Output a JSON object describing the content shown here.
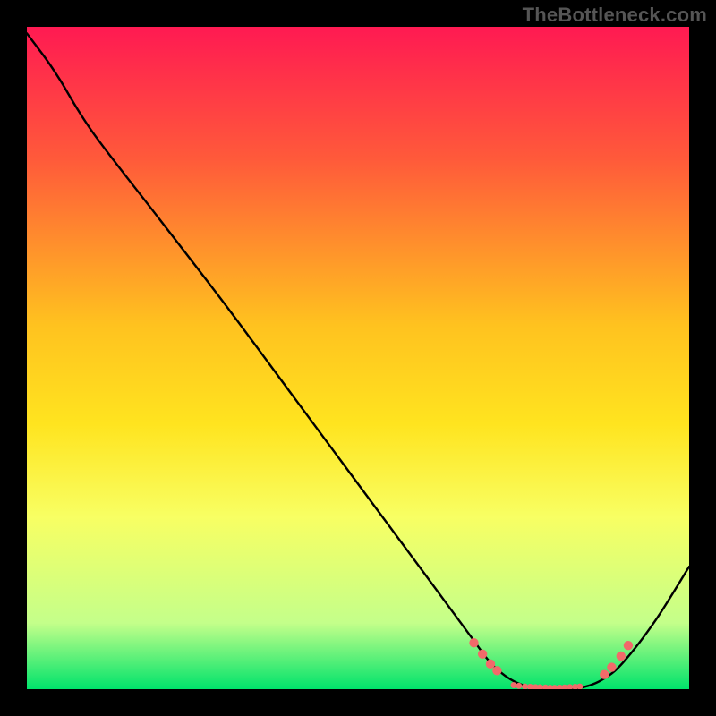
{
  "watermark": "TheBottleneck.com",
  "chart_data": {
    "type": "line",
    "title": "",
    "xlabel": "",
    "ylabel": "",
    "xlim": [
      0,
      100
    ],
    "ylim": [
      0,
      100
    ],
    "background_gradient_stops": [
      {
        "offset": 0.0,
        "color": "#ff1a52"
      },
      {
        "offset": 0.2,
        "color": "#ff5a3a"
      },
      {
        "offset": 0.45,
        "color": "#ffc21f"
      },
      {
        "offset": 0.6,
        "color": "#ffe41f"
      },
      {
        "offset": 0.74,
        "color": "#f8ff63"
      },
      {
        "offset": 0.9,
        "color": "#c4ff8a"
      },
      {
        "offset": 1.0,
        "color": "#00e36b"
      }
    ],
    "series": [
      {
        "name": "bottleneck-curve",
        "color": "#000000",
        "points": [
          {
            "x": 0.0,
            "y": 99.0
          },
          {
            "x": 3.0,
            "y": 95.0
          },
          {
            "x": 5.0,
            "y": 92.0
          },
          {
            "x": 10.0,
            "y": 84.0
          },
          {
            "x": 20.0,
            "y": 71.0
          },
          {
            "x": 30.0,
            "y": 58.0
          },
          {
            "x": 40.0,
            "y": 44.5
          },
          {
            "x": 50.0,
            "y": 31.0
          },
          {
            "x": 60.0,
            "y": 17.5
          },
          {
            "x": 67.0,
            "y": 8.0
          },
          {
            "x": 70.0,
            "y": 4.0
          },
          {
            "x": 73.0,
            "y": 1.5
          },
          {
            "x": 76.0,
            "y": 0.3
          },
          {
            "x": 80.0,
            "y": 0.0
          },
          {
            "x": 84.0,
            "y": 0.3
          },
          {
            "x": 87.0,
            "y": 1.5
          },
          {
            "x": 90.0,
            "y": 4.0
          },
          {
            "x": 95.0,
            "y": 10.5
          },
          {
            "x": 100.0,
            "y": 18.5
          }
        ]
      }
    ],
    "markers": {
      "color": "#f26a6a",
      "radius_big": 5.2,
      "radius_small": 3.4,
      "points": [
        {
          "x": 67.5,
          "y": 7.0,
          "size": "big"
        },
        {
          "x": 68.8,
          "y": 5.3,
          "size": "big"
        },
        {
          "x": 70.0,
          "y": 3.8,
          "size": "big"
        },
        {
          "x": 71.0,
          "y": 2.8,
          "size": "big"
        },
        {
          "x": 73.5,
          "y": 0.6,
          "size": "small"
        },
        {
          "x": 74.3,
          "y": 0.5,
          "size": "small"
        },
        {
          "x": 75.2,
          "y": 0.4,
          "size": "small"
        },
        {
          "x": 76.0,
          "y": 0.35,
          "size": "small"
        },
        {
          "x": 76.8,
          "y": 0.3,
          "size": "small"
        },
        {
          "x": 77.5,
          "y": 0.28,
          "size": "small"
        },
        {
          "x": 78.3,
          "y": 0.25,
          "size": "small"
        },
        {
          "x": 79.0,
          "y": 0.22,
          "size": "small"
        },
        {
          "x": 79.7,
          "y": 0.2,
          "size": "small"
        },
        {
          "x": 80.5,
          "y": 0.22,
          "size": "small"
        },
        {
          "x": 81.2,
          "y": 0.25,
          "size": "small"
        },
        {
          "x": 82.0,
          "y": 0.3,
          "size": "small"
        },
        {
          "x": 82.8,
          "y": 0.35,
          "size": "small"
        },
        {
          "x": 83.5,
          "y": 0.4,
          "size": "small"
        },
        {
          "x": 87.2,
          "y": 2.2,
          "size": "big"
        },
        {
          "x": 88.3,
          "y": 3.3,
          "size": "big"
        },
        {
          "x": 89.7,
          "y": 5.0,
          "size": "big"
        },
        {
          "x": 90.8,
          "y": 6.6,
          "size": "big"
        }
      ]
    }
  }
}
